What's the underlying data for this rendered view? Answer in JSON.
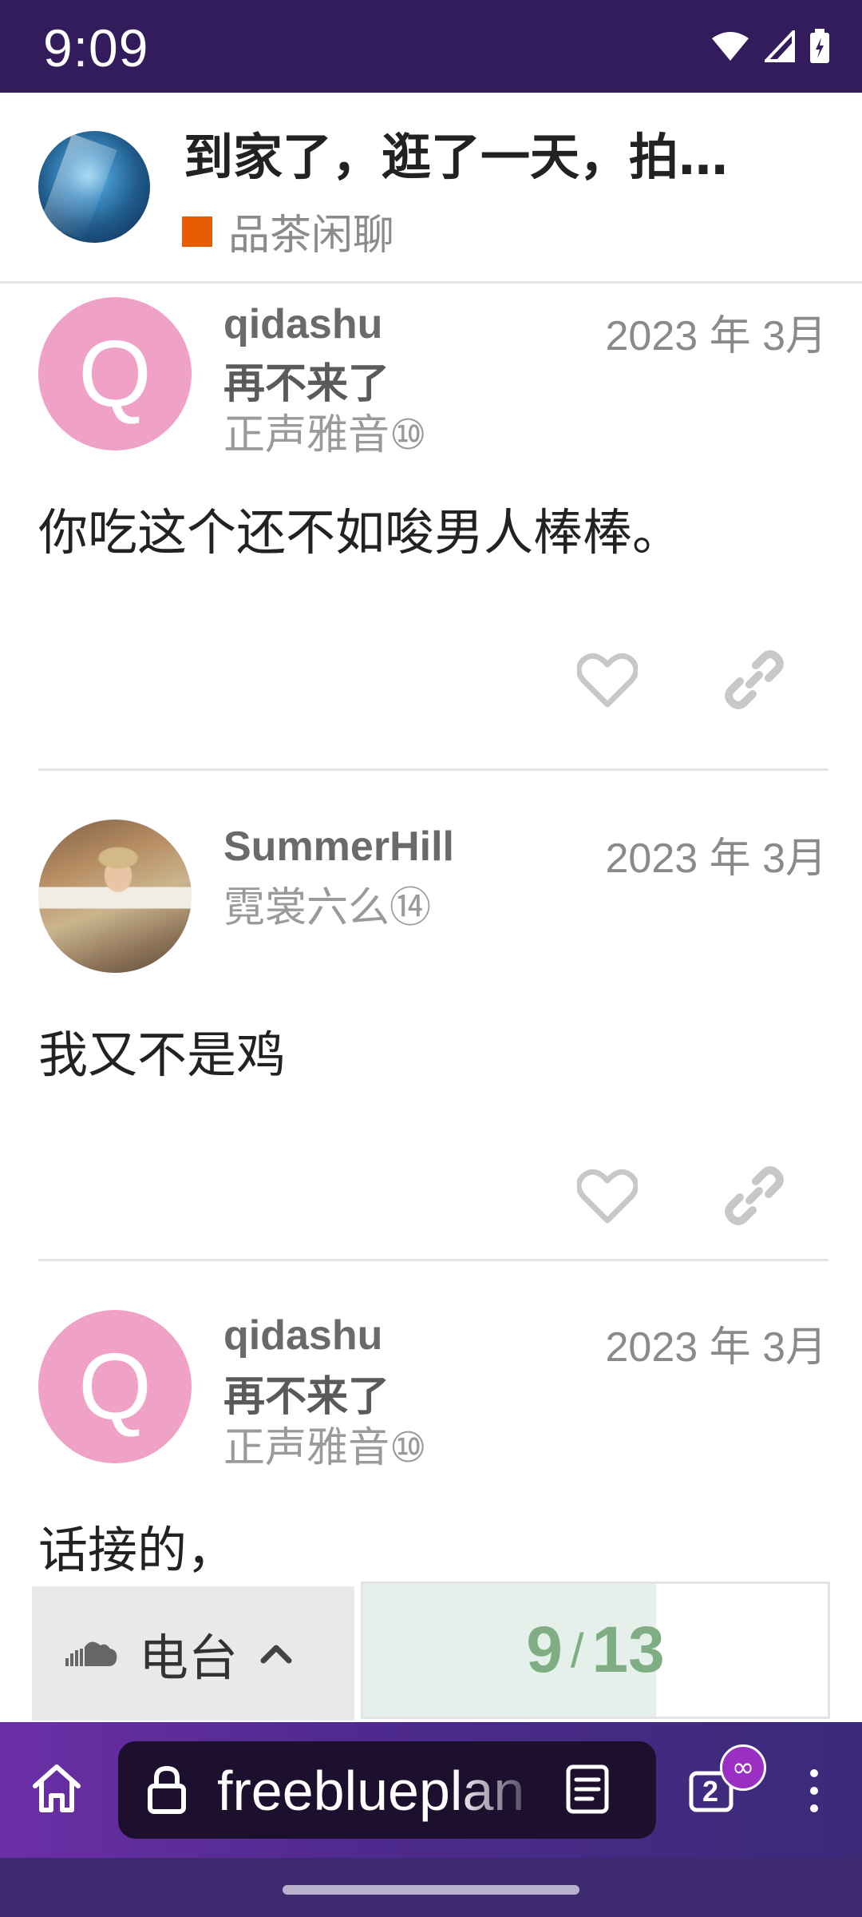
{
  "status_bar": {
    "time": "9:09"
  },
  "topic": {
    "title": "到家了，逛了一天，拍…",
    "category": "品茶闲聊",
    "category_color": "#e85d04"
  },
  "posts": [
    {
      "avatar_letter": "Q",
      "username": "qidashu",
      "user_title": "再不来了",
      "flair": "正声雅音⑩",
      "date": "2023 年 3月",
      "body": "你吃这个还不如唆男人棒棒。"
    },
    {
      "avatar_letter": "",
      "username": "SummerHill",
      "user_title": "",
      "flair": "霓裳六么⑭",
      "date": "2023 年 3月",
      "body": "我又不是鸡"
    },
    {
      "avatar_letter": "Q",
      "username": "qidashu",
      "user_title": "再不来了",
      "flair": "正声雅音⑩",
      "date": "2023 年 3月",
      "body": "话接的，"
    }
  ],
  "radio": {
    "label": "电台"
  },
  "progress": {
    "current": "9",
    "total": "13",
    "fraction": 0.63
  },
  "browser": {
    "url": "freeblueplan",
    "tab_count": "2",
    "badge": "∞"
  },
  "icons": {
    "like": "heart-outline-icon",
    "share": "link-icon",
    "cloud": "cloud-icon",
    "home": "home-icon",
    "lock": "lock-icon",
    "reader": "reader-mode-icon",
    "tabs": "tabs-icon",
    "menu": "more-vert-icon"
  },
  "colors": {
    "status_bar_bg": "#331c5c",
    "avatar_pink": "#f0a2c6",
    "progress_green": "#7fae85",
    "browser_bar": "#4f2a8f"
  }
}
